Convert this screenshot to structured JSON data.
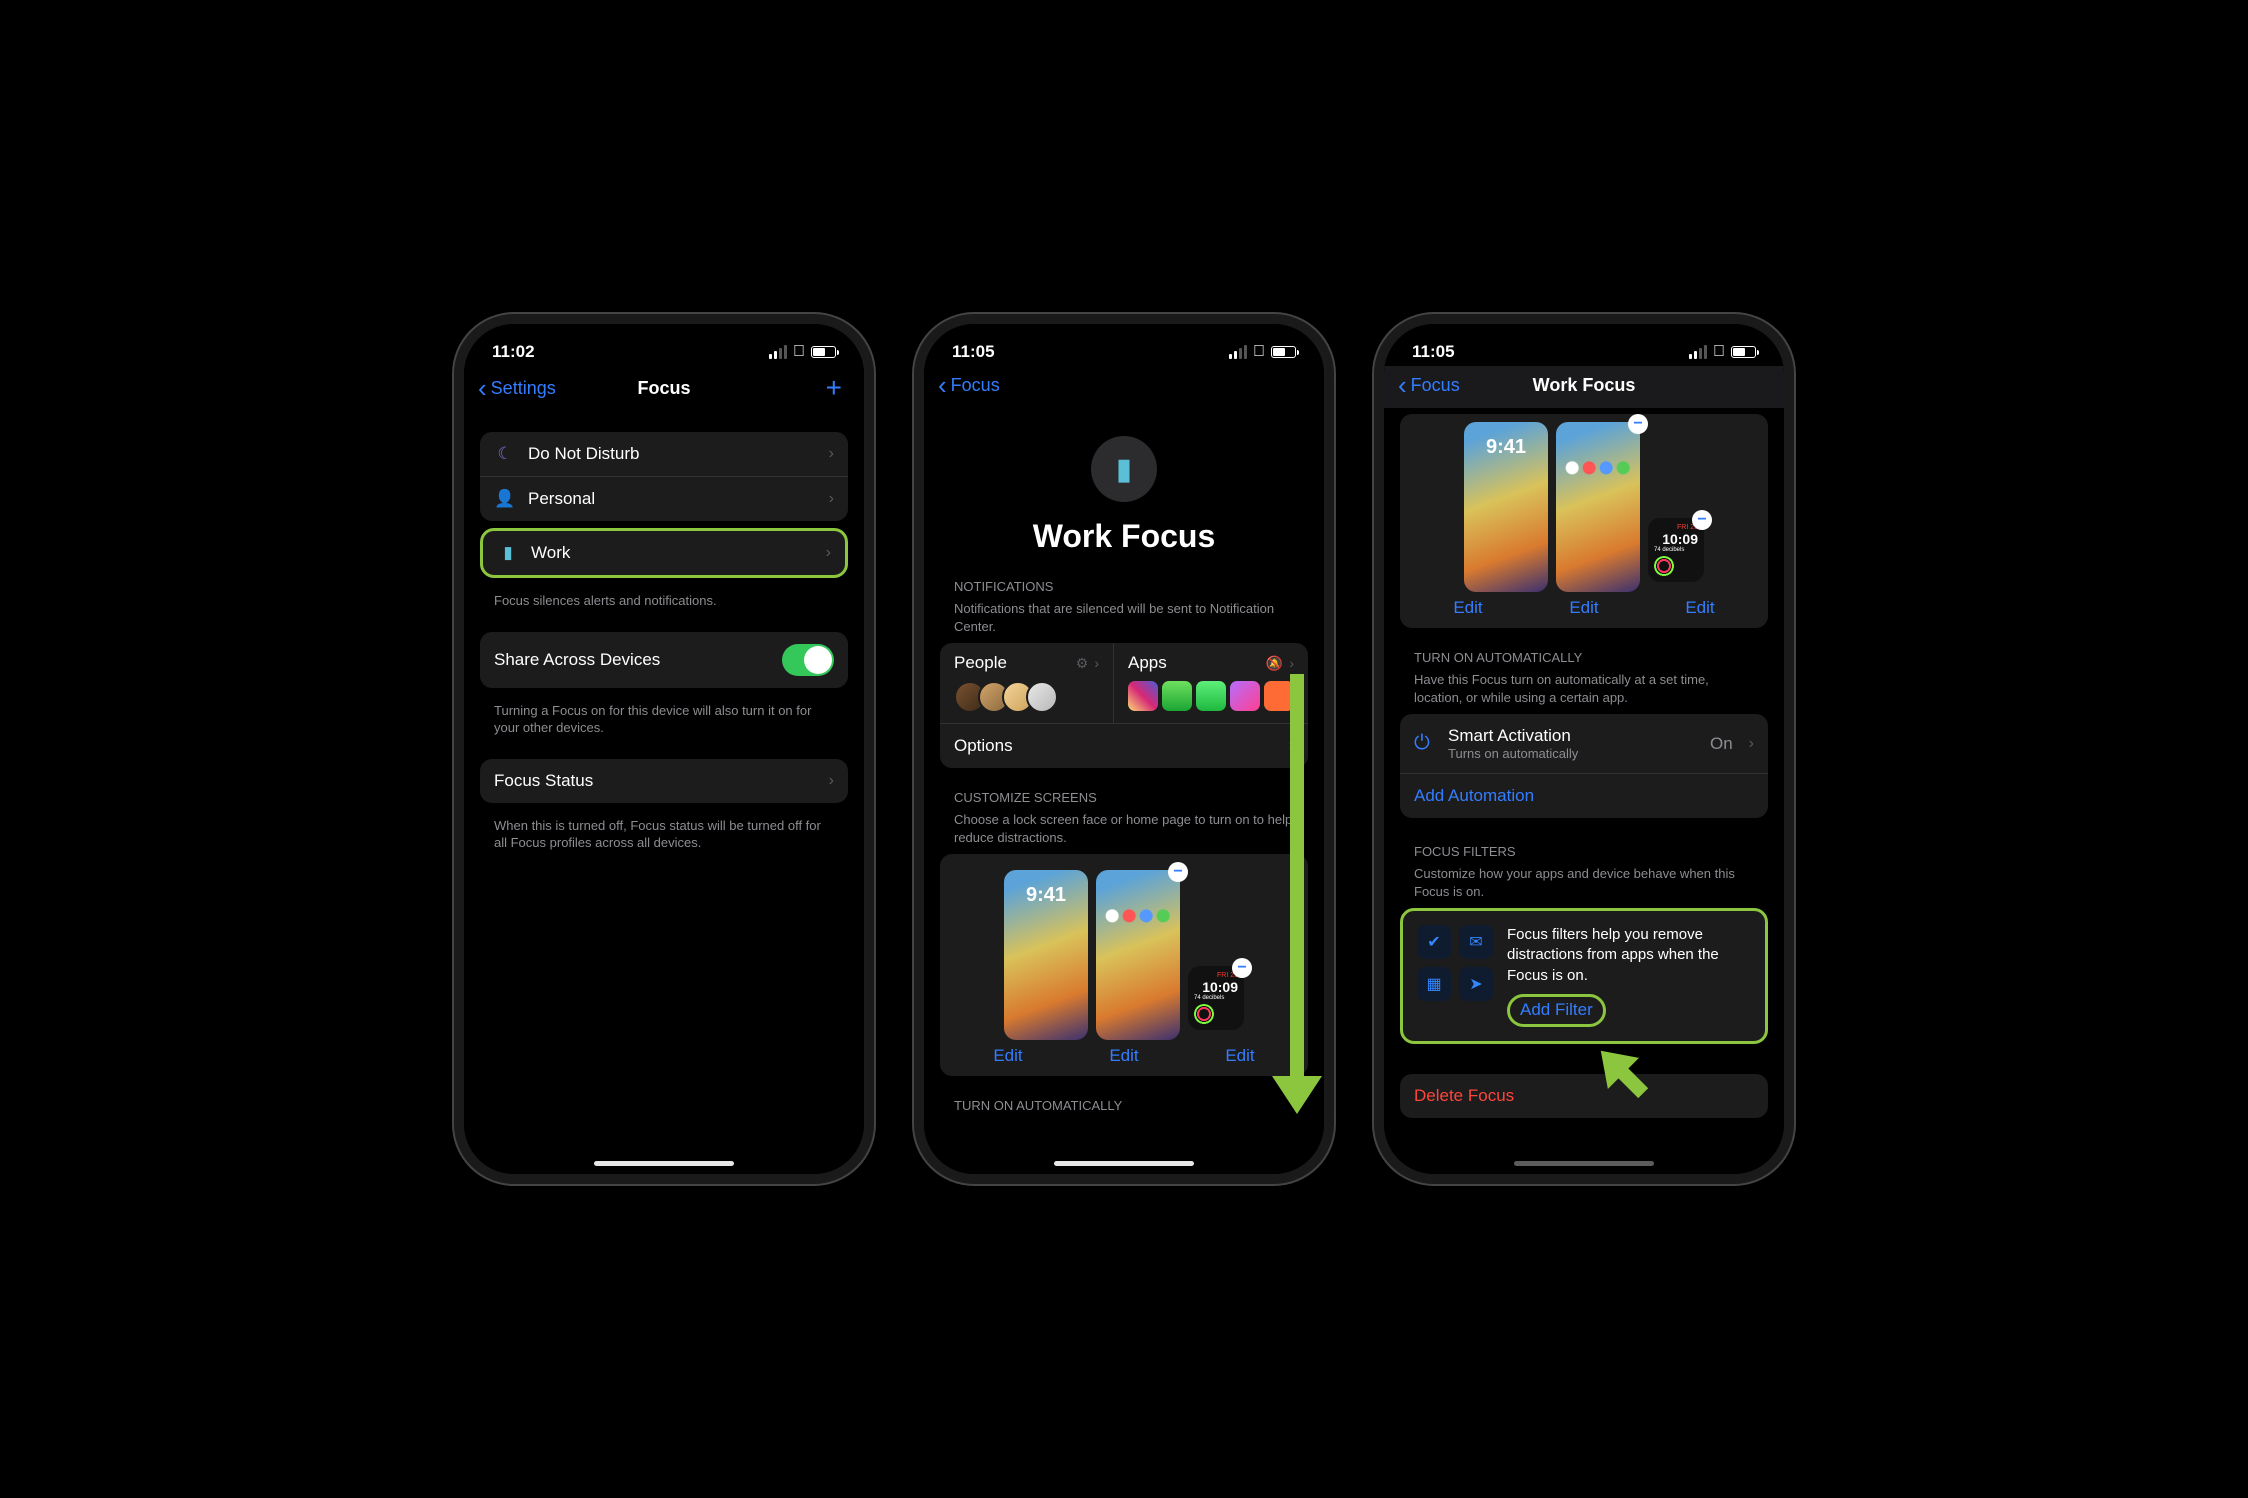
{
  "status": {
    "time1": "11:02",
    "time2": "11:05",
    "time3": "11:05"
  },
  "screen1": {
    "back": "Settings",
    "title": "Focus",
    "rows": {
      "dnd": "Do Not Disturb",
      "personal": "Personal",
      "work": "Work"
    },
    "footer1": "Focus silences alerts and notifications.",
    "share": "Share Across Devices",
    "footer2": "Turning a Focus on for this device will also turn it on for your other devices.",
    "status": "Focus Status",
    "footer3": "When this is turned off, Focus status will be turned off for all Focus profiles across all devices."
  },
  "screen2": {
    "back": "Focus",
    "title": "Work Focus",
    "notif_header": "NOTIFICATIONS",
    "notif_sub": "Notifications that are silenced will be sent to Notification Center.",
    "people": "People",
    "apps": "Apps",
    "options": "Options",
    "cust_header": "CUSTOMIZE SCREENS",
    "cust_sub": "Choose a lock screen face or home page to turn on to help reduce distractions.",
    "edit": "Edit",
    "lock_time": "9:41",
    "watch_day": "FRI 23",
    "watch_time": "10:09",
    "watch_db": "74 decibels",
    "auto_header": "TURN ON AUTOMATICALLY"
  },
  "screen3": {
    "back": "Focus",
    "title": "Work Focus",
    "edit": "Edit",
    "lock_time": "9:41",
    "watch_day": "FRI 23",
    "watch_time": "10:09",
    "watch_db": "74 decibels",
    "auto_header": "TURN ON AUTOMATICALLY",
    "auto_sub": "Have this Focus turn on automatically at a set time, location, or while using a certain app.",
    "smart": "Smart Activation",
    "smart_sub": "Turns on automatically",
    "on": "On",
    "add_auto": "Add Automation",
    "filters_header": "FOCUS FILTERS",
    "filters_sub": "Customize how your apps and device behave when this Focus is on.",
    "filters_text": "Focus filters help you remove distractions from apps when the Focus is on.",
    "add_filter": "Add Filter",
    "delete": "Delete Focus"
  }
}
